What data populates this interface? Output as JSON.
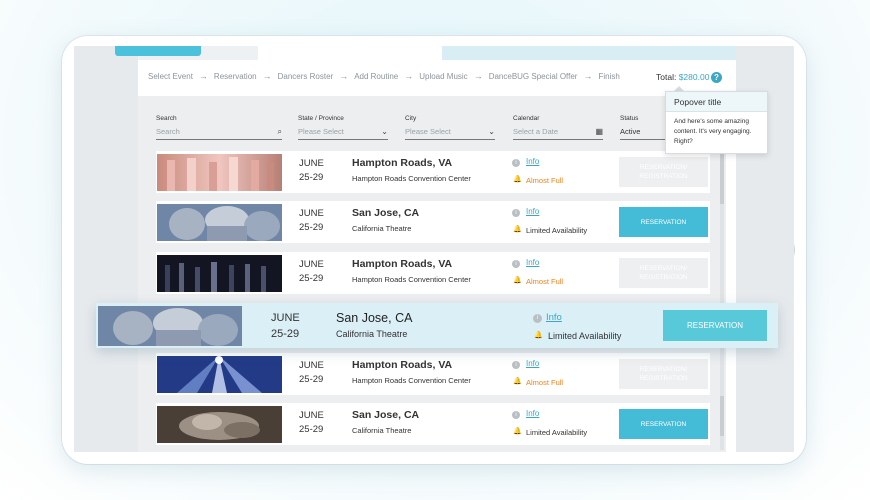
{
  "steps": [
    "Select Event",
    "Reservation",
    "Dancers Roster",
    "Add Routine",
    "Upload Music",
    "DanceBUG Special Offer",
    "Finish"
  ],
  "step_arrow": "→",
  "total": {
    "label": "Total:",
    "amount": "$280.00"
  },
  "help_icon": "?",
  "filters": {
    "search": {
      "label": "Search",
      "placeholder": "Search"
    },
    "state": {
      "label": "State / Province",
      "placeholder": "Please Select"
    },
    "city": {
      "label": "City",
      "placeholder": "Please Select"
    },
    "calendar": {
      "label": "Calendar",
      "placeholder": "Select a Date"
    },
    "status": {
      "label": "Status",
      "value": "Active"
    }
  },
  "popover": {
    "title": "Popover title",
    "body": "And here's some amazing content. It's very engaging. Right?"
  },
  "events": [
    {
      "month": "JUNE",
      "days": "25-29",
      "city": "Hampton Roads, VA",
      "venue": "Hampton Roads Convention Center",
      "info": "Info",
      "availability": "Almost Full",
      "availability_type": "orange",
      "button": "RESERVATION/ REGISTRATION",
      "button_state": "disabled",
      "thumb": "dancers-pink"
    },
    {
      "month": "JUNE",
      "days": "25-29",
      "city": "San Jose, CA",
      "venue": "California Theatre",
      "info": "Info",
      "availability": "Limited Availability",
      "availability_type": "gray",
      "button": "RESERVATION",
      "button_state": "active",
      "thumb": "statue-blue"
    },
    {
      "month": "JUNE",
      "days": "25-29",
      "city": "Hampton Roads, VA",
      "venue": "Hampton Roads Convention Center",
      "info": "Info",
      "availability": "Almost Full",
      "availability_type": "orange",
      "button": "RESERVATION/ REGISTRATION",
      "button_state": "disabled",
      "thumb": "dancers-dark"
    },
    {
      "month": "JUNE",
      "days": "25-29",
      "city": "Hampton Roads, VA",
      "venue": "Hampton Roads Convention Center",
      "info": "Info",
      "availability": "Almost Full",
      "availability_type": "orange",
      "button": "RESERVATION/ REGISTRATION",
      "button_state": "disabled",
      "thumb": "stage-lights"
    },
    {
      "month": "JUNE",
      "days": "25-29",
      "city": "San Jose, CA",
      "venue": "California Theatre",
      "info": "Info",
      "availability": "Limited Availability",
      "availability_type": "gray",
      "button": "RESERVATION",
      "button_state": "active",
      "thumb": "statue-brown"
    }
  ],
  "hover_event": {
    "month": "JUNE",
    "days": "25-29",
    "city": "San Jose, CA",
    "venue": "California Theatre",
    "info": "Info",
    "availability": "Limited Availability",
    "button": "RESERVATION",
    "thumb": "statue-blue"
  },
  "icons": {
    "info": "i",
    "bell": "🔔",
    "chevron": "⌄",
    "search": "⌕",
    "calendar": "▦"
  },
  "colors": {
    "accent": "#45bcd7",
    "orange": "#f0821c",
    "link": "#3aa7c6"
  }
}
